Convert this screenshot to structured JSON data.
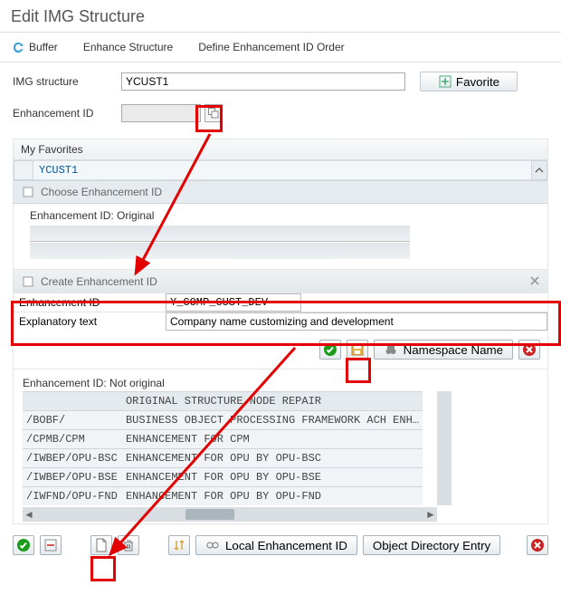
{
  "page_title": "Edit IMG Structure",
  "toolbar": {
    "buffer": "Buffer",
    "enhance": "Enhance Structure",
    "define_order": "Define Enhancement ID Order"
  },
  "form": {
    "img_struct_label": "IMG structure",
    "img_struct_value": "YCUST1",
    "favorite_btn": "Favorite",
    "enh_id_label": "Enhancement ID",
    "enh_id_value": ""
  },
  "favorites": {
    "header": "My Favorites",
    "items": [
      "YCUST1"
    ],
    "choose_hdr": "Choose Enhancement ID"
  },
  "orig_section": {
    "title": "Enhancement ID: Original"
  },
  "create_dialog": {
    "header": "Create Enhancement ID",
    "enh_id_label": "Enhancement ID",
    "enh_id_value": "Y_COMP_CUST_DEV",
    "expl_label": "Explanatory text",
    "expl_value": "Company name customizing and development",
    "ns_btn": "Namespace Name"
  },
  "not_orig": {
    "title": "Enhancement ID: Not original",
    "rows": [
      [
        "",
        "ORIGINAL STRUCTURE NODE REPAIR"
      ],
      [
        "/BOBF/",
        "BUSINESS OBJECT PROCESSING FRAMEWORK ACH ENH…"
      ],
      [
        "/CPMB/CPM",
        "ENHANCEMENT FOR CPM"
      ],
      [
        "/IWBEP/OPU-BSC",
        "ENHANCEMENT FOR OPU BY OPU-BSC"
      ],
      [
        "/IWBEP/OPU-BSE",
        "ENHANCEMENT FOR OPU BY OPU-BSE"
      ],
      [
        "/IWFND/OPU-FND",
        "ENHANCEMENT FOR OPU BY OPU-FND"
      ]
    ]
  },
  "bottom": {
    "local_enh": "Local Enhancement ID",
    "obj_dir": "Object Directory Entry"
  }
}
